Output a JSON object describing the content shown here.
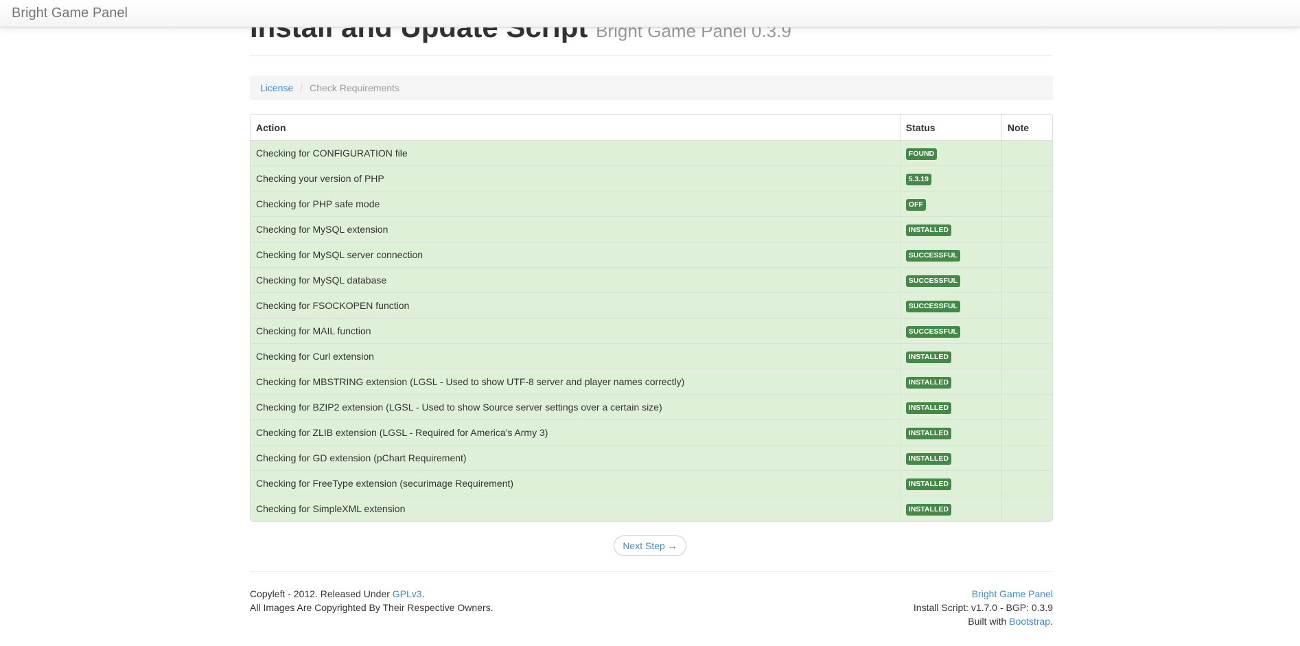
{
  "navbar": {
    "brand": "Bright Game Panel"
  },
  "header": {
    "title": "Install and Update Script",
    "subtitle": "Bright Game Panel 0.3.9"
  },
  "breadcrumb": {
    "items": [
      "License",
      "Check Requirements"
    ],
    "separator": "/"
  },
  "table": {
    "headers": {
      "action": "Action",
      "status": "Status",
      "note": "Note"
    },
    "rows": [
      {
        "action": "Checking for CONFIGURATION file",
        "status": "FOUND",
        "note": ""
      },
      {
        "action": "Checking your version of PHP",
        "status": "5.3.19",
        "note": ""
      },
      {
        "action": "Checking for PHP safe mode",
        "status": "OFF",
        "note": ""
      },
      {
        "action": "Checking for MySQL extension",
        "status": "INSTALLED",
        "note": ""
      },
      {
        "action": "Checking for MySQL server connection",
        "status": "SUCCESSFUL",
        "note": ""
      },
      {
        "action": "Checking for MySQL database",
        "status": "SUCCESSFUL",
        "note": ""
      },
      {
        "action": "Checking for FSOCKOPEN function",
        "status": "SUCCESSFUL",
        "note": ""
      },
      {
        "action": "Checking for MAIL function",
        "status": "SUCCESSFUL",
        "note": ""
      },
      {
        "action": "Checking for Curl extension",
        "status": "INSTALLED",
        "note": ""
      },
      {
        "action": "Checking for MBSTRING extension (LGSL - Used to show UTF-8 server and player names correctly)",
        "status": "INSTALLED",
        "note": ""
      },
      {
        "action": "Checking for BZIP2 extension (LGSL - Used to show Source server settings over a certain size)",
        "status": "INSTALLED",
        "note": ""
      },
      {
        "action": "Checking for ZLIB extension (LGSL - Required for America's Army 3)",
        "status": "INSTALLED",
        "note": ""
      },
      {
        "action": "Checking for GD extension (pChart Requirement)",
        "status": "INSTALLED",
        "note": ""
      },
      {
        "action": "Checking for FreeType extension (securimage Requirement)",
        "status": "INSTALLED",
        "note": ""
      },
      {
        "action": "Checking for SimpleXML extension",
        "status": "INSTALLED",
        "note": ""
      }
    ]
  },
  "next_button": {
    "label": "Next Step →"
  },
  "footer": {
    "left_line1_prefix": "Copyleft - 2012. Released Under ",
    "left_line1_link": "GPLv3",
    "left_line1_suffix": ".",
    "left_line2": "All Images Are Copyrighted By Their Respective Owners.",
    "right_line1_link": "Bright Game Panel",
    "right_line2": "Install Script: v1.7.0 - BGP: 0.3.9",
    "right_line3_prefix": "Built with ",
    "right_line3_link": "Bootstrap",
    "right_line3_suffix": "."
  },
  "colors": {
    "link": "#428bca",
    "success_row": "#dff0d8",
    "success_label": "#468847"
  }
}
